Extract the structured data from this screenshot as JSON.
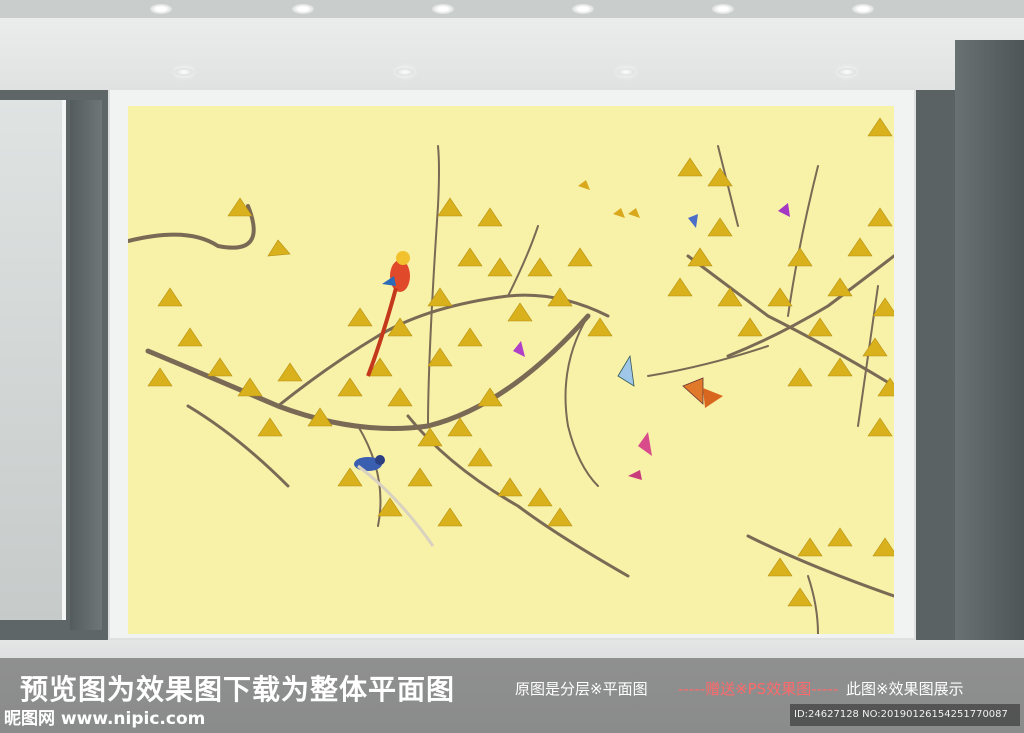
{
  "banner": {
    "headline": "预览图为效果图下载为整体平面图",
    "sub_notes": [
      "原图是分层※平面图",
      "-----赠送※PS效果图-----",
      "此图※效果图展示"
    ],
    "site": "昵图网 www.nipic.com",
    "image_id": "ID:24627128 NO:20190126154251770087"
  },
  "scene": {
    "mural_background": "#f8f1a8",
    "leaf_color": "#d9b11c",
    "branch_color": "#7a6a55",
    "elements": [
      "ginkgo-branches",
      "golden-pheasant",
      "blue-bird",
      "butterflies",
      "small-yellow-birds"
    ]
  }
}
